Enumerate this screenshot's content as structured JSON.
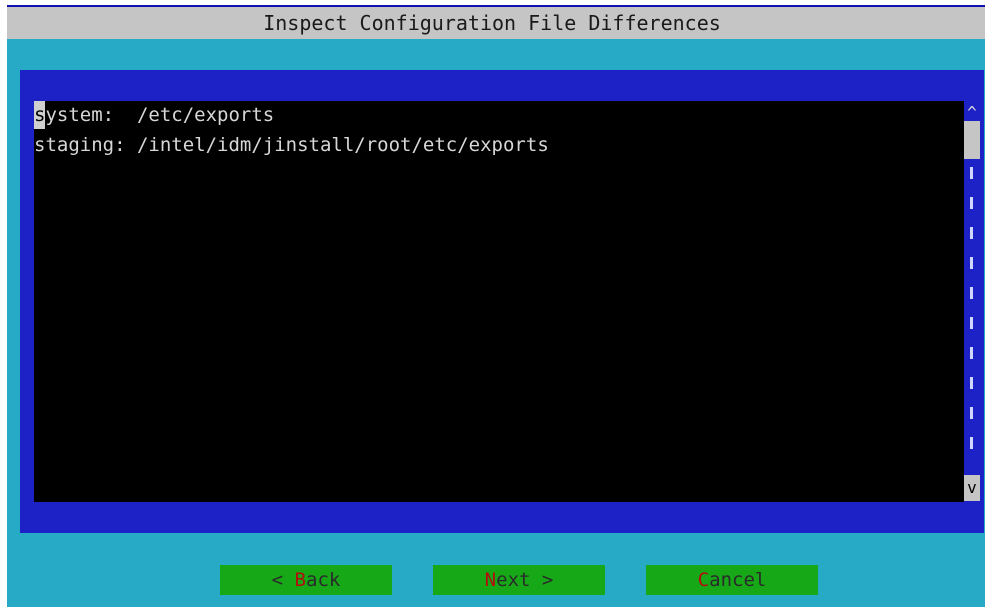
{
  "window": {
    "title": "Inspect Configuration File Differences"
  },
  "viewer": {
    "lines": [
      {
        "cursor_char": "s",
        "rest": "ystem:  /etc/exports"
      },
      {
        "text": "staging: /intel/idm/jinstall/root/etc/exports"
      }
    ],
    "overflow_char": "r"
  },
  "scrollbar": {
    "up_glyph": "^",
    "down_glyph": "v",
    "track_glyph": "|"
  },
  "buttons": {
    "back": {
      "prefix": "< ",
      "hotkey": "B",
      "suffix": "ack"
    },
    "next": {
      "prefix": "",
      "hotkey": "N",
      "suffix": "ext >"
    },
    "cancel": {
      "prefix": "",
      "hotkey": "C",
      "suffix": "ancel"
    }
  },
  "colors": {
    "background": "#26aac6",
    "title_bar": "#c5c5c5",
    "dialog": "#1c22c6",
    "viewer": "#000000",
    "button": "#17a817",
    "hotkey": "#b40c0c"
  }
}
